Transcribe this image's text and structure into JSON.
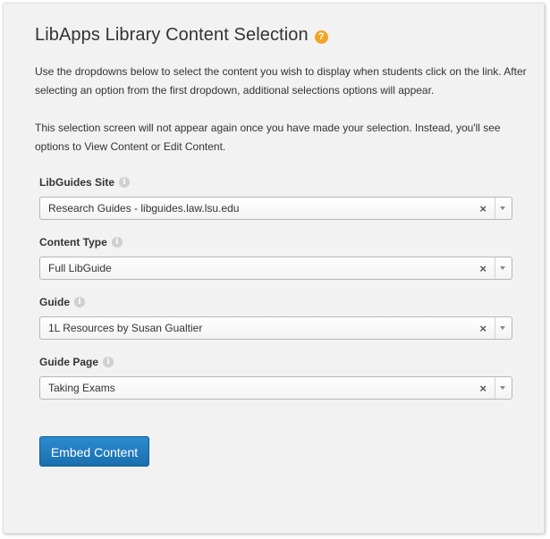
{
  "header": {
    "title": "LibApps Library Content Selection",
    "help_icon": "?"
  },
  "intro": {
    "line1": "Use the dropdowns below to select the content you wish to display when students click on the link. After selecting an option from the first dropdown, additional selections options will appear.",
    "line2": "This selection screen will not appear again once you have made your selection. Instead, you'll see options to View Content or Edit Content."
  },
  "fields": [
    {
      "label": "LibGuides Site",
      "value": "Research Guides - libguides.law.lsu.edu"
    },
    {
      "label": "Content Type",
      "value": "Full LibGuide"
    },
    {
      "label": "Guide",
      "value": "1L Resources by Susan Gualtier"
    },
    {
      "label": "Guide Page",
      "value": "Taking Exams"
    }
  ],
  "icons": {
    "info": "i",
    "clear": "×"
  },
  "actions": {
    "embed_label": "Embed Content"
  },
  "colors": {
    "accent": "#1a6fae",
    "help": "#f0a527"
  }
}
